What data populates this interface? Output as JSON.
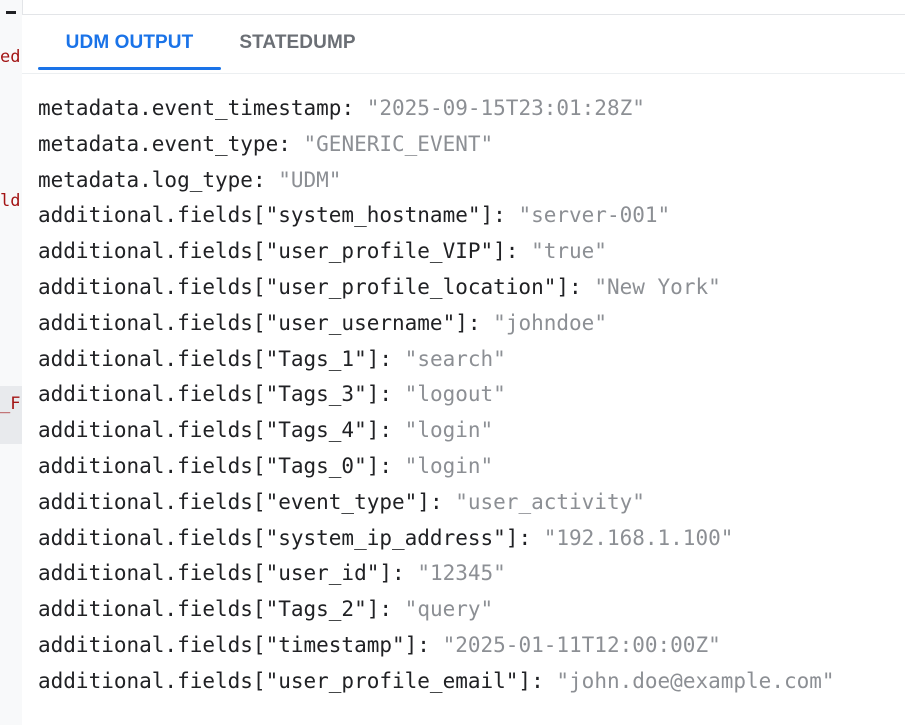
{
  "left_gutter": {
    "fragments": [
      "ed",
      "ld",
      "_F"
    ]
  },
  "tabs": [
    {
      "label": "UDM OUTPUT",
      "active": true
    },
    {
      "label": "STATEDUMP",
      "active": false
    }
  ],
  "colors": {
    "accent": "#1a73e8",
    "key_text": "#202124",
    "value_text": "#8c8f94",
    "inactive_tab_text": "#6b6f75",
    "gutter_fragment_text": "#a31515"
  },
  "udm_output": {
    "lines": [
      {
        "key": "metadata.event_timestamp",
        "separator": ": ",
        "value": "\"2025-09-15T23:01:28Z\""
      },
      {
        "key": "metadata.event_type",
        "separator": ": ",
        "value": "\"GENERIC_EVENT\""
      },
      {
        "key": "metadata.log_type",
        "separator": ": ",
        "value": "\"UDM\""
      },
      {
        "key": "additional.fields[\"system_hostname\"]",
        "separator": ": ",
        "value": "\"server-001\""
      },
      {
        "key": "additional.fields[\"user_profile_VIP\"]",
        "separator": ": ",
        "value": "\"true\""
      },
      {
        "key": "additional.fields[\"user_profile_location\"]",
        "separator": ": ",
        "value": "\"New York\""
      },
      {
        "key": "additional.fields[\"user_username\"]",
        "separator": ": ",
        "value": "\"johndoe\""
      },
      {
        "key": "additional.fields[\"Tags_1\"]",
        "separator": ": ",
        "value": "\"search\""
      },
      {
        "key": "additional.fields[\"Tags_3\"]",
        "separator": ": ",
        "value": "\"logout\""
      },
      {
        "key": "additional.fields[\"Tags_4\"]",
        "separator": ": ",
        "value": "\"login\""
      },
      {
        "key": "additional.fields[\"Tags_0\"]",
        "separator": ": ",
        "value": "\"login\""
      },
      {
        "key": "additional.fields[\"event_type\"]",
        "separator": ": ",
        "value": "\"user_activity\""
      },
      {
        "key": "additional.fields[\"system_ip_address\"]",
        "separator": ": ",
        "value": "\"192.168.1.100\""
      },
      {
        "key": "additional.fields[\"user_id\"]",
        "separator": ": ",
        "value": "\"12345\""
      },
      {
        "key": "additional.fields[\"Tags_2\"]",
        "separator": ": ",
        "value": "\"query\""
      },
      {
        "key": "additional.fields[\"timestamp\"]",
        "separator": ": ",
        "value": "\"2025-01-11T12:00:00Z\""
      },
      {
        "key": "additional.fields[\"user_profile_email\"]",
        "separator": ": ",
        "value": "\"john.doe@example.com\""
      }
    ]
  }
}
